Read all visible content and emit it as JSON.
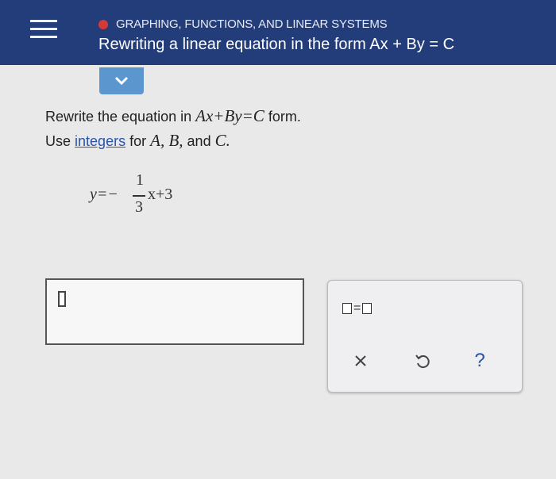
{
  "header": {
    "topic": "GRAPHING, FUNCTIONS, AND LINEAR SYSTEMS",
    "title": "Rewriting a linear equation in the form Ax + By = C",
    "topic_dot_color": "#d63a36",
    "background": "#233d7a"
  },
  "question": {
    "line1_text": "Rewrite the equation in",
    "line1_form": "Ax+By=C",
    "line1_end": "form.",
    "line2_use": "Use",
    "line2_link": "integers",
    "line2_for": "for",
    "line2_vars": "A, B,",
    "line2_and": "and",
    "line2_c": "C."
  },
  "equation": {
    "lhs": "y=−",
    "numerator": "1",
    "denominator": "3",
    "rhs": "x+3"
  },
  "answer": {
    "value": ""
  },
  "palette": {
    "equal_tool": "□=□",
    "clear_icon": "x-icon",
    "undo_icon": "undo-icon",
    "help_label": "?"
  },
  "colors": {
    "accent_tab": "#5c96cf",
    "link": "#2a53a8"
  }
}
